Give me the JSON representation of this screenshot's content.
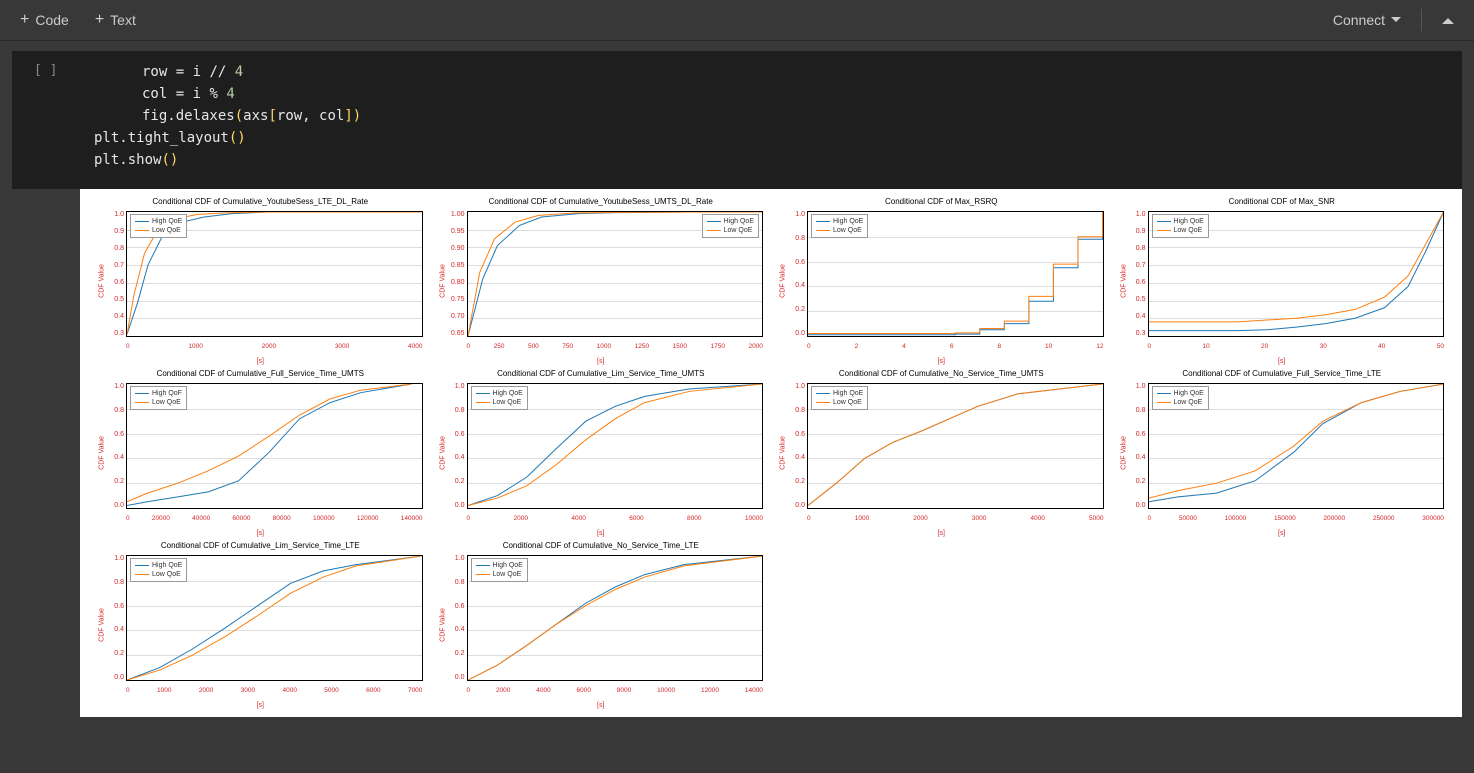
{
  "toolbar": {
    "code_label": "Code",
    "text_label": "Text",
    "connect_label": "Connect"
  },
  "code_cell": {
    "prompt": "[ ]",
    "lines": [
      {
        "indent": 1,
        "tokens": [
          {
            "t": "row ",
            "c": ""
          },
          {
            "t": "=",
            "c": ""
          },
          {
            "t": " i ",
            "c": ""
          },
          {
            "t": "//",
            "c": ""
          },
          {
            "t": " ",
            "c": ""
          },
          {
            "t": "4",
            "c": "k-num"
          }
        ]
      },
      {
        "indent": 1,
        "tokens": [
          {
            "t": "col ",
            "c": ""
          },
          {
            "t": "=",
            "c": ""
          },
          {
            "t": " i ",
            "c": ""
          },
          {
            "t": "%",
            "c": ""
          },
          {
            "t": " ",
            "c": ""
          },
          {
            "t": "4",
            "c": "k-num"
          }
        ]
      },
      {
        "indent": 1,
        "tokens": [
          {
            "t": "fig.delaxes",
            "c": ""
          },
          {
            "t": "(",
            "c": "k-par"
          },
          {
            "t": "axs",
            "c": ""
          },
          {
            "t": "[",
            "c": "k-brk"
          },
          {
            "t": "row, col",
            "c": ""
          },
          {
            "t": "]",
            "c": "k-brk"
          },
          {
            "t": ")",
            "c": "k-par"
          }
        ]
      },
      {
        "indent": 0,
        "tokens": [
          {
            "t": "",
            "c": ""
          }
        ]
      },
      {
        "indent": 0,
        "tokens": [
          {
            "t": "plt.tight_layout",
            "c": ""
          },
          {
            "t": "()",
            "c": "k-par"
          }
        ]
      },
      {
        "indent": 0,
        "tokens": [
          {
            "t": "plt.show",
            "c": ""
          },
          {
            "t": "()",
            "c": "k-par"
          }
        ]
      }
    ]
  },
  "colors": {
    "high": "#1f77b4",
    "low": "#ff7f0e"
  },
  "legend": {
    "high": "High QoE",
    "low": "Low QoE"
  },
  "chart_data": [
    {
      "title": "Conditional CDF of Cumulative_YoutubeSess_LTE_DL_Rate",
      "xlabel": "[s]",
      "ylabel": "CDF Value",
      "xticks": [
        "0",
        "1000",
        "2000",
        "3000",
        "4000"
      ],
      "yticks": [
        "1.0",
        "0.9",
        "0.8",
        "0.7",
        "0.6",
        "0.5",
        "0.4",
        "0.3"
      ],
      "ylim": [
        0.25,
        1.0
      ],
      "xrange": [
        0,
        4200
      ],
      "legend_pos": "left",
      "series": [
        {
          "name": "High QoE",
          "color": "#1f77b4",
          "x": [
            0,
            150,
            300,
            500,
            800,
            1100,
            1500,
            2000,
            3000,
            4200
          ],
          "y": [
            0.26,
            0.45,
            0.68,
            0.85,
            0.94,
            0.97,
            0.99,
            1.0,
            1.0,
            1.0
          ]
        },
        {
          "name": "Low QoE",
          "color": "#ff7f0e",
          "x": [
            0,
            100,
            250,
            450,
            700,
            1000,
            1400,
            2000,
            3000,
            4200
          ],
          "y": [
            0.26,
            0.5,
            0.75,
            0.9,
            0.96,
            0.985,
            0.995,
            1.0,
            1.0,
            1.0
          ]
        }
      ]
    },
    {
      "title": "Conditional CDF of Cumulative_YoutubeSess_UMTS_DL_Rate",
      "xlabel": "[s]",
      "ylabel": "CDF Value",
      "xticks": [
        "0",
        "250",
        "500",
        "750",
        "1000",
        "1250",
        "1500",
        "1750",
        "2000"
      ],
      "yticks": [
        "1.00",
        "0.95",
        "0.90",
        "0.85",
        "0.80",
        "0.75",
        "0.70",
        "0.65"
      ],
      "ylim": [
        0.63,
        1.0
      ],
      "xrange": [
        0,
        2000
      ],
      "legend_pos": "right",
      "series": [
        {
          "name": "High QoE",
          "color": "#1f77b4",
          "x": [
            0,
            100,
            200,
            350,
            500,
            750,
            1000,
            1500,
            2000
          ],
          "y": [
            0.63,
            0.8,
            0.9,
            0.96,
            0.985,
            0.995,
            0.998,
            1.0,
            1.0
          ]
        },
        {
          "name": "Low QoE",
          "color": "#ff7f0e",
          "x": [
            0,
            80,
            180,
            320,
            480,
            720,
            1000,
            1500,
            2000
          ],
          "y": [
            0.63,
            0.82,
            0.92,
            0.97,
            0.99,
            0.997,
            0.999,
            1.0,
            1.0
          ]
        }
      ]
    },
    {
      "title": "Conditional CDF of Max_RSRQ",
      "xlabel": "[s]",
      "ylabel": "CDF Value",
      "xticks": [
        "0",
        "2",
        "4",
        "6",
        "8",
        "10",
        "12"
      ],
      "yticks": [
        "1.0",
        "0.8",
        "0.6",
        "0.4",
        "0.2",
        "0.0"
      ],
      "ylim": [
        0,
        1.0
      ],
      "xrange": [
        0,
        12
      ],
      "legend_pos": "left",
      "series": [
        {
          "name": "High QoE",
          "color": "#1f77b4",
          "x": [
            0,
            6,
            6,
            7,
            7,
            8,
            8,
            9,
            9,
            10,
            10,
            11,
            11,
            12,
            12
          ],
          "y": [
            0.01,
            0.01,
            0.015,
            0.015,
            0.05,
            0.05,
            0.1,
            0.1,
            0.28,
            0.28,
            0.55,
            0.55,
            0.78,
            0.78,
            1.0
          ]
        },
        {
          "name": "Low QoE",
          "color": "#ff7f0e",
          "x": [
            0,
            6,
            6,
            7,
            7,
            8,
            8,
            9,
            9,
            10,
            10,
            11,
            11,
            12,
            12
          ],
          "y": [
            0.02,
            0.02,
            0.025,
            0.025,
            0.06,
            0.06,
            0.12,
            0.12,
            0.32,
            0.32,
            0.58,
            0.58,
            0.8,
            0.8,
            1.0
          ]
        }
      ]
    },
    {
      "title": "Conditional CDF of Max_SNR",
      "xlabel": "[s]",
      "ylabel": "CDF Value",
      "xticks": [
        "0",
        "10",
        "20",
        "30",
        "40",
        "50"
      ],
      "yticks": [
        "1.0",
        "0.9",
        "0.8",
        "0.7",
        "0.6",
        "0.5",
        "0.4",
        "0.3"
      ],
      "ylim": [
        0.3,
        1.0
      ],
      "xrange": [
        0,
        50
      ],
      "legend_pos": "left",
      "series": [
        {
          "name": "High QoE",
          "color": "#1f77b4",
          "x": [
            0,
            15,
            20,
            25,
            30,
            35,
            40,
            44,
            47,
            50
          ],
          "y": [
            0.33,
            0.33,
            0.335,
            0.35,
            0.37,
            0.4,
            0.46,
            0.58,
            0.78,
            1.0
          ]
        },
        {
          "name": "Low QoE",
          "color": "#ff7f0e",
          "x": [
            0,
            15,
            20,
            25,
            30,
            35,
            40,
            44,
            47,
            50
          ],
          "y": [
            0.38,
            0.38,
            0.39,
            0.4,
            0.42,
            0.45,
            0.52,
            0.64,
            0.82,
            1.0
          ]
        }
      ]
    },
    {
      "title": "Conditional CDF of Cumulative_Full_Service_Time_UMTS",
      "xlabel": "[s]",
      "ylabel": "CDF Value",
      "xticks": [
        "0",
        "20000",
        "40000",
        "60000",
        "80000",
        "100000",
        "120000",
        "140000"
      ],
      "yticks": [
        "1.0",
        "0.8",
        "0.6",
        "0.4",
        "0.2",
        "0.0"
      ],
      "ylim": [
        0,
        1.0
      ],
      "xrange": [
        0,
        145000
      ],
      "legend_pos": "left",
      "series": [
        {
          "name": "High QoF",
          "color": "#1f77b4",
          "x": [
            0,
            10000,
            25000,
            40000,
            55000,
            70000,
            85000,
            100000,
            115000,
            140000
          ],
          "y": [
            0.02,
            0.05,
            0.09,
            0.13,
            0.22,
            0.45,
            0.72,
            0.85,
            0.93,
            1.0
          ]
        },
        {
          "name": "Low QoE",
          "color": "#ff7f0e",
          "x": [
            0,
            10000,
            25000,
            40000,
            55000,
            70000,
            85000,
            100000,
            115000,
            140000
          ],
          "y": [
            0.05,
            0.12,
            0.2,
            0.3,
            0.42,
            0.58,
            0.75,
            0.88,
            0.95,
            1.0
          ]
        }
      ]
    },
    {
      "title": "Conditional CDF of Cumulative_Lim_Service_Time_UMTS",
      "xlabel": "[s]",
      "ylabel": "CDF Value",
      "xticks": [
        "0",
        "2000",
        "4000",
        "6000",
        "8000",
        "10000"
      ],
      "yticks": [
        "1.0",
        "0.8",
        "0.6",
        "0.4",
        "0.2",
        "0.0"
      ],
      "ylim": [
        0,
        1.0
      ],
      "xrange": [
        0,
        10000
      ],
      "legend_pos": "left",
      "series": [
        {
          "name": "High QoE",
          "color": "#1f77b4",
          "x": [
            0,
            1000,
            2000,
            3000,
            4000,
            5000,
            6000,
            7500,
            10000
          ],
          "y": [
            0.02,
            0.1,
            0.25,
            0.48,
            0.7,
            0.82,
            0.9,
            0.96,
            1.0
          ]
        },
        {
          "name": "Low QoE",
          "color": "#ff7f0e",
          "x": [
            0,
            1000,
            2000,
            3000,
            4000,
            5000,
            6000,
            7500,
            10000
          ],
          "y": [
            0.02,
            0.08,
            0.18,
            0.35,
            0.55,
            0.72,
            0.85,
            0.94,
            1.0
          ]
        }
      ]
    },
    {
      "title": "Conditional CDF of Cumulative_No_Service_Time_UMTS",
      "xlabel": "[s]",
      "ylabel": "CDF Value",
      "xticks": [
        "0",
        "1000",
        "2000",
        "3000",
        "4000",
        "5000"
      ],
      "yticks": [
        "1.0",
        "0.8",
        "0.6",
        "0.4",
        "0.2",
        "0.0"
      ],
      "ylim": [
        0,
        1.0
      ],
      "xrange": [
        0,
        5200
      ],
      "legend_pos": "left",
      "series": [
        {
          "name": "High QoE",
          "color": "#1f77b4",
          "x": [
            0,
            500,
            1000,
            1500,
            2000,
            2500,
            3000,
            3700,
            5200
          ],
          "y": [
            0.02,
            0.2,
            0.4,
            0.53,
            0.62,
            0.72,
            0.82,
            0.92,
            1.0
          ]
        },
        {
          "name": "Low QoE",
          "color": "#ff7f0e",
          "x": [
            0,
            500,
            1000,
            1500,
            2000,
            2500,
            3000,
            3700,
            5200
          ],
          "y": [
            0.02,
            0.2,
            0.4,
            0.53,
            0.62,
            0.72,
            0.82,
            0.92,
            1.0
          ]
        }
      ]
    },
    {
      "title": "Conditional CDF of Cumulative_Full_Service_Time_LTE",
      "xlabel": "[s]",
      "ylabel": "CDF Value",
      "xticks": [
        "0",
        "50000",
        "100000",
        "150000",
        "200000",
        "250000",
        "300000"
      ],
      "yticks": [
        "1.0",
        "0.8",
        "0.6",
        "0.4",
        "0.2",
        "0.0"
      ],
      "ylim": [
        0,
        1.0
      ],
      "xrange": [
        0,
        305000
      ],
      "legend_pos": "left",
      "series": [
        {
          "name": "High QoE",
          "color": "#1f77b4",
          "x": [
            0,
            30000,
            70000,
            110000,
            150000,
            180000,
            220000,
            260000,
            305000
          ],
          "y": [
            0.05,
            0.09,
            0.12,
            0.22,
            0.45,
            0.68,
            0.85,
            0.94,
            1.0
          ]
        },
        {
          "name": "Low QoE",
          "color": "#ff7f0e",
          "x": [
            0,
            30000,
            70000,
            110000,
            150000,
            180000,
            220000,
            260000,
            305000
          ],
          "y": [
            0.08,
            0.14,
            0.2,
            0.3,
            0.5,
            0.7,
            0.85,
            0.94,
            1.0
          ]
        }
      ]
    },
    {
      "title": "Conditional CDF of Cumulative_Lim_Service_Time_LTE",
      "xlabel": "[s]",
      "ylabel": "CDF Value",
      "xticks": [
        "0",
        "1000",
        "2000",
        "3000",
        "4000",
        "5000",
        "6000",
        "7000"
      ],
      "yticks": [
        "1.0",
        "0.8",
        "0.6",
        "0.4",
        "0.2",
        "0.0"
      ],
      "ylim": [
        0,
        1.0
      ],
      "xrange": [
        0,
        7200
      ],
      "legend_pos": "left",
      "series": [
        {
          "name": "High QoE",
          "color": "#1f77b4",
          "x": [
            0,
            800,
            1600,
            2400,
            3200,
            4000,
            4800,
            5600,
            7200
          ],
          "y": [
            0.0,
            0.1,
            0.25,
            0.42,
            0.6,
            0.78,
            0.88,
            0.93,
            1.0
          ]
        },
        {
          "name": "Low QoE",
          "color": "#ff7f0e",
          "x": [
            0,
            800,
            1600,
            2400,
            3200,
            4000,
            4800,
            5600,
            7200
          ],
          "y": [
            0.0,
            0.08,
            0.2,
            0.35,
            0.52,
            0.7,
            0.83,
            0.92,
            1.0
          ]
        }
      ]
    },
    {
      "title": "Conditional CDF of Cumulative_No_Service_Time_LTE",
      "xlabel": "[s]",
      "ylabel": "CDF Value",
      "xticks": [
        "0",
        "2000",
        "4000",
        "6000",
        "8000",
        "10000",
        "12000",
        "14000"
      ],
      "yticks": [
        "1.0",
        "0.8",
        "0.6",
        "0.4",
        "0.2",
        "0.0"
      ],
      "ylim": [
        0,
        1.0
      ],
      "xrange": [
        0,
        15000
      ],
      "legend_pos": "left",
      "series": [
        {
          "name": "High QoE",
          "color": "#1f77b4",
          "x": [
            0,
            1500,
            3000,
            4500,
            6000,
            7500,
            9000,
            11000,
            15000
          ],
          "y": [
            0.0,
            0.12,
            0.28,
            0.45,
            0.62,
            0.75,
            0.85,
            0.93,
            1.0
          ]
        },
        {
          "name": "Low QoE",
          "color": "#ff7f0e",
          "x": [
            0,
            1500,
            3000,
            4500,
            6000,
            7500,
            9000,
            11000,
            15000
          ],
          "y": [
            0.0,
            0.12,
            0.28,
            0.45,
            0.6,
            0.73,
            0.83,
            0.92,
            1.0
          ]
        }
      ]
    },
    null,
    null
  ]
}
